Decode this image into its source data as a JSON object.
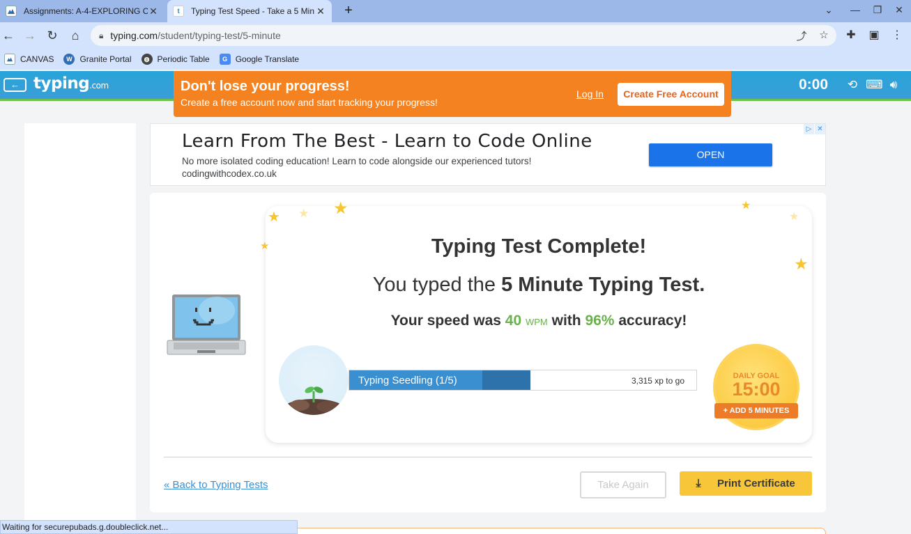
{
  "browser": {
    "tabs": [
      {
        "title": "Assignments: A-4-EXPLORING C",
        "favicon": "canvas-icon"
      },
      {
        "title": "Typing Test Speed - Take a 5 Min",
        "favicon": "t"
      }
    ],
    "new_tab": "+",
    "url_host": "typing.com",
    "url_path": "/student/typing-test/5-minute",
    "bookmarks": [
      {
        "label": "CANVAS"
      },
      {
        "label": "Granite Portal"
      },
      {
        "label": "Periodic Table"
      },
      {
        "label": "Google Translate"
      }
    ],
    "status_text": "Waiting for securepubads.g.doubleclick.net..."
  },
  "site": {
    "logo": "typing",
    "logo_suffix": ".com",
    "timer": "0:00"
  },
  "promo": {
    "title": "Don't lose your progress!",
    "subtitle": "Create a free account now and start tracking your progress!",
    "login": "Log In",
    "create": "Create Free Account"
  },
  "ad": {
    "headline": "Learn From The Best - Learn to Code Online",
    "description": "No more isolated coding education! Learn to code alongside our experienced tutors!",
    "url": "codingwithcodex.co.uk",
    "button": "OPEN"
  },
  "results": {
    "title": "Typing Test Complete!",
    "typed_prefix": "You typed the",
    "test_name": "5 Minute Typing Test.",
    "speed_prefix": "Your speed was",
    "wpm_value": "40",
    "wpm_unit": "WPM",
    "with": "with",
    "accuracy": "96%",
    "accuracy_suffix": "accuracy!"
  },
  "level": {
    "label": "Typing Seedling (1/5)",
    "xp_to_go": "3,315 xp to go"
  },
  "daily_goal": {
    "label": "DAILY GOAL",
    "time": "15:00",
    "add_button": "+ ADD 5 MINUTES"
  },
  "actions": {
    "back": "« Back to Typing Tests",
    "take_again": "Take Again",
    "print": "Print Certificate"
  }
}
